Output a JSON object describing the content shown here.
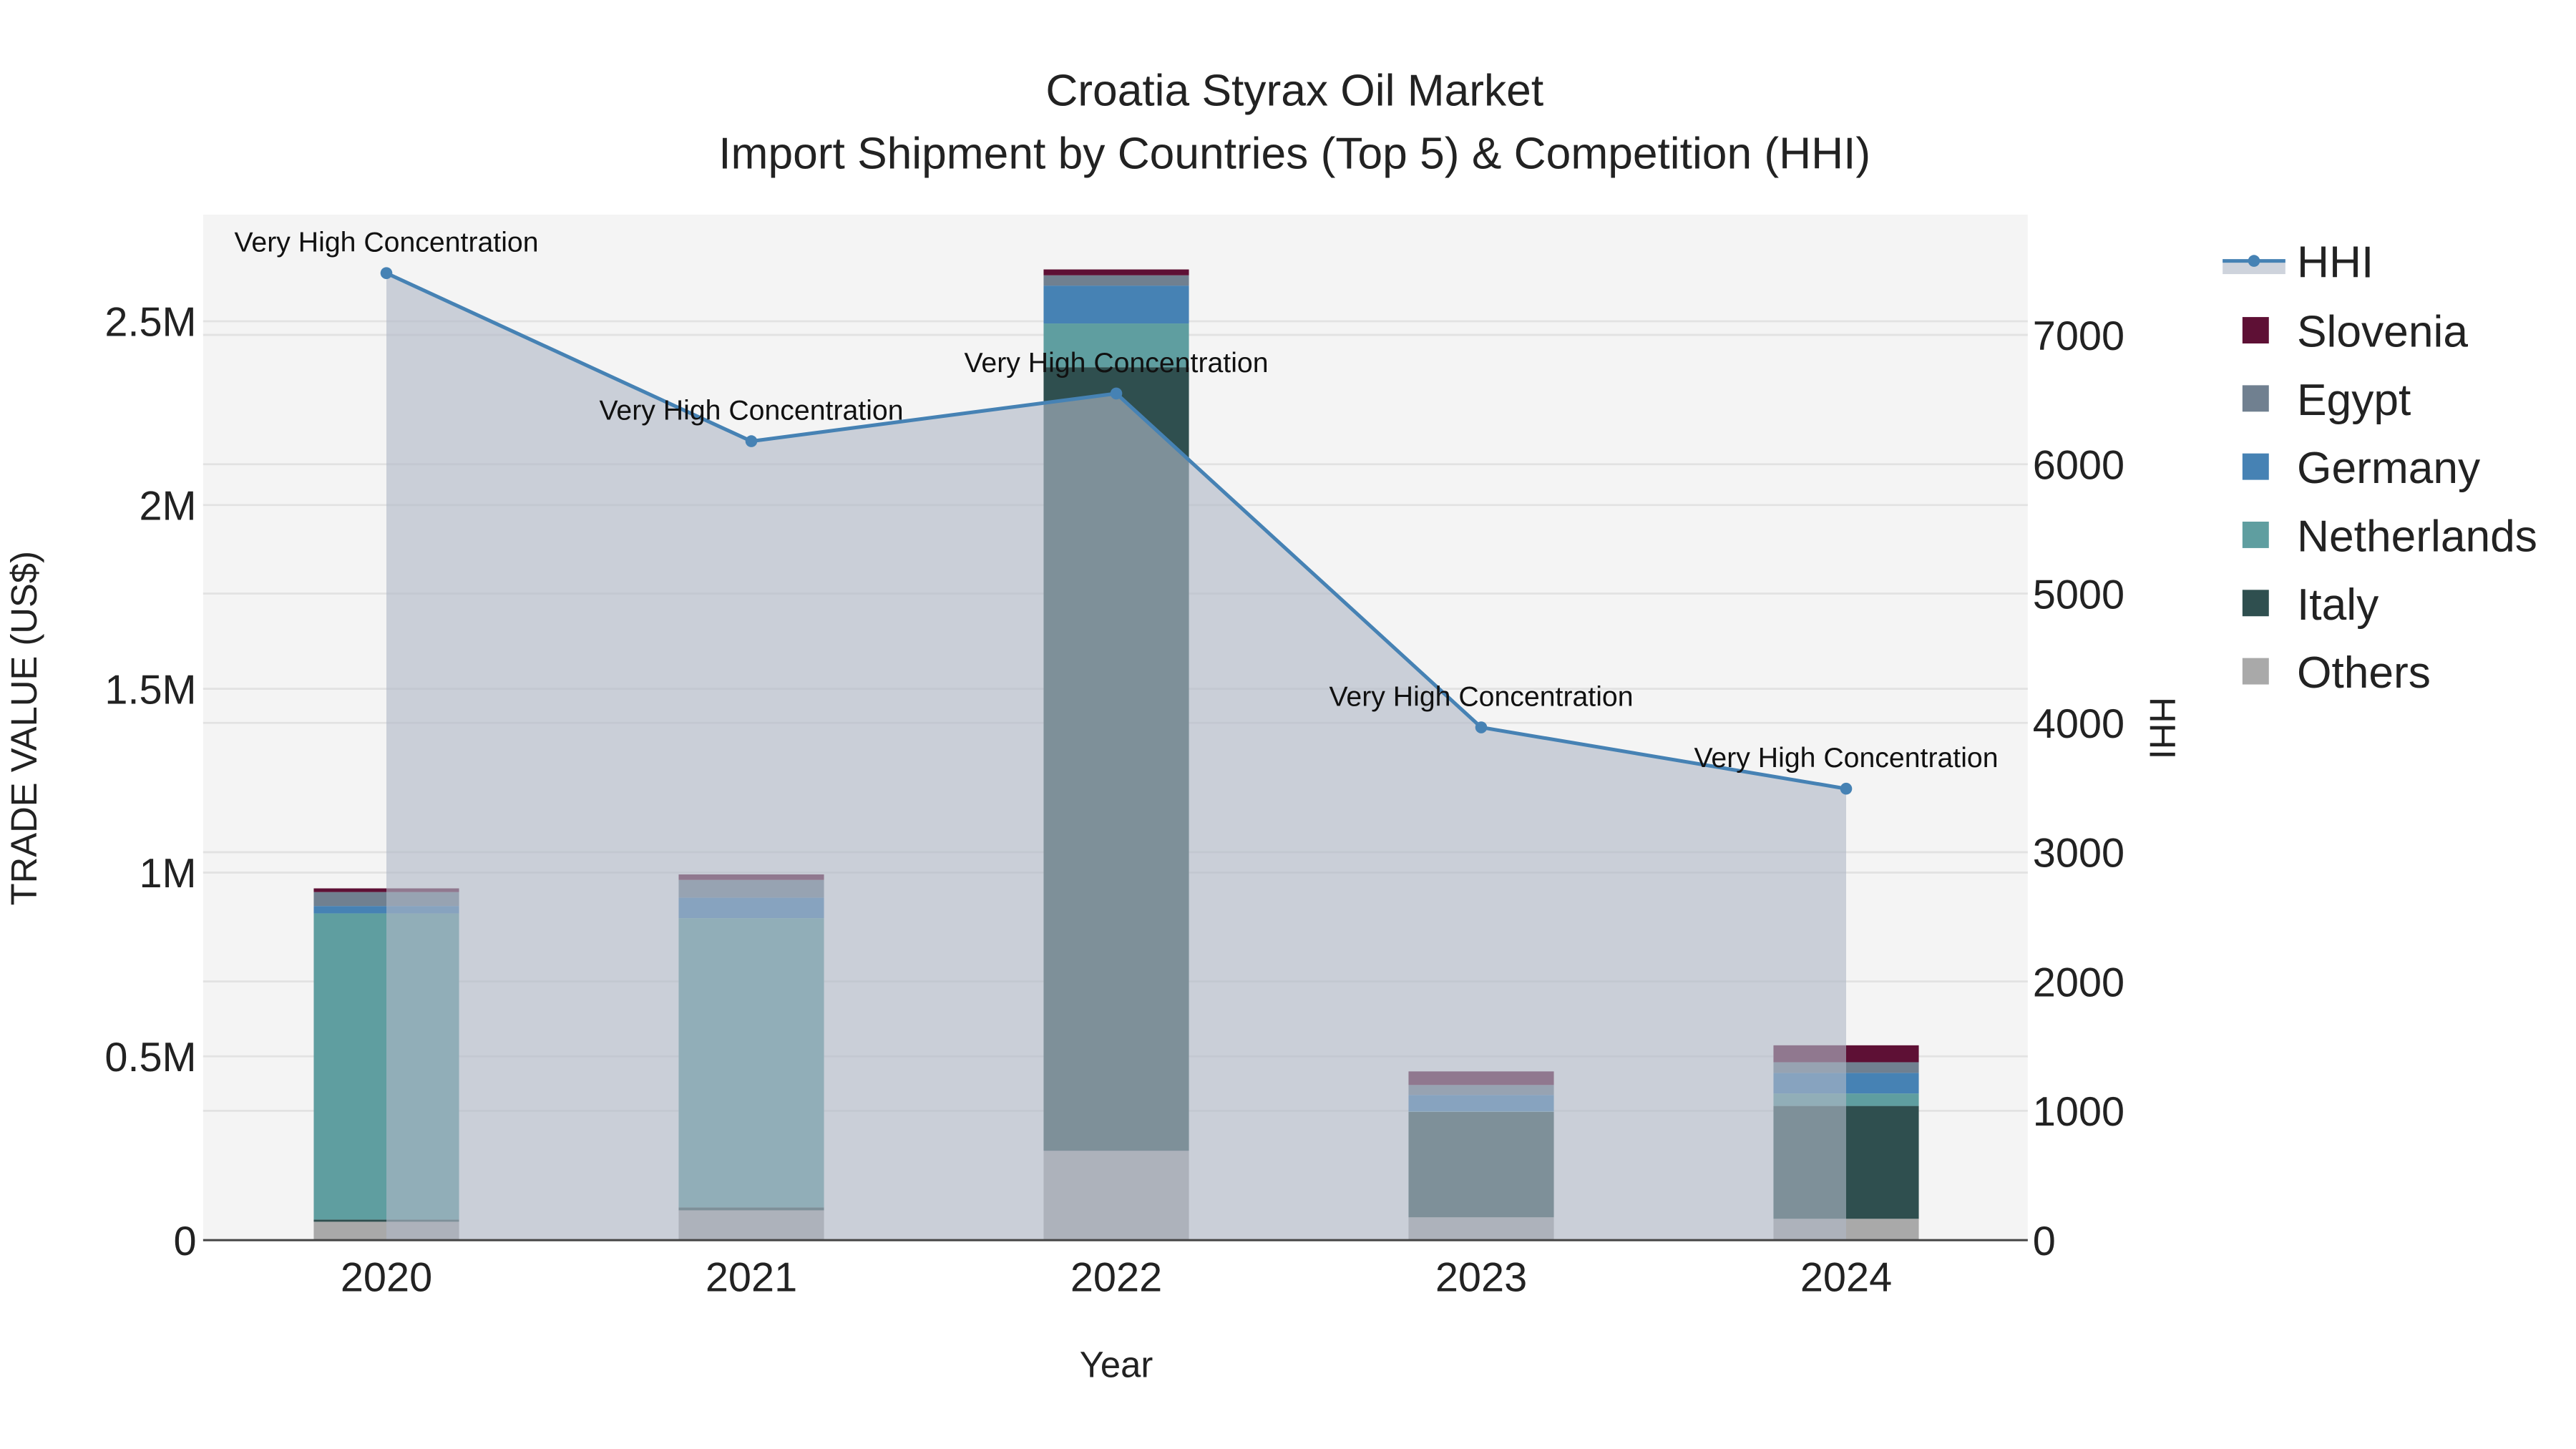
{
  "chart_data": {
    "type": "bar",
    "title": "Croatia Styrax Oil Market",
    "subtitle": "Import Shipment by Countries (Top 5) & Competition (HHI)",
    "xlabel": "Year",
    "ylabel": "TRADE VALUE (US$)",
    "y2label": "HHI",
    "categories": [
      "2020",
      "2021",
      "2022",
      "2023",
      "2024"
    ],
    "ylim": [
      0,
      2790000
    ],
    "y2lim": [
      0,
      7930
    ],
    "yticks": [
      {
        "v": 0,
        "label": "0"
      },
      {
        "v": 500000,
        "label": "0.5M"
      },
      {
        "v": 1000000,
        "label": "1M"
      },
      {
        "v": 1500000,
        "label": "1.5M"
      },
      {
        "v": 2000000,
        "label": "2M"
      },
      {
        "v": 2500000,
        "label": "2.5M"
      }
    ],
    "y2ticks": [
      {
        "v": 0,
        "label": "0"
      },
      {
        "v": 1000,
        "label": "1000"
      },
      {
        "v": 2000,
        "label": "2000"
      },
      {
        "v": 3000,
        "label": "3000"
      },
      {
        "v": 4000,
        "label": "4000"
      },
      {
        "v": 5000,
        "label": "5000"
      },
      {
        "v": 6000,
        "label": "6000"
      },
      {
        "v": 7000,
        "label": "7000"
      }
    ],
    "stacked": true,
    "series": [
      {
        "name": "Others",
        "color": "#a9a9a9",
        "values": [
          50000,
          81000,
          243000,
          62000,
          58000
        ]
      },
      {
        "name": "Italy",
        "color": "#2f4f4f",
        "values": [
          6000,
          8000,
          2132000,
          287000,
          307000
        ]
      },
      {
        "name": "Netherlands",
        "color": "#5f9ea0",
        "values": [
          833000,
          787000,
          119000,
          1000,
          34000
        ]
      },
      {
        "name": "Germany",
        "color": "#4682b4",
        "values": [
          20000,
          56000,
          103000,
          45000,
          56000
        ]
      },
      {
        "name": "Egypt",
        "color": "#708090",
        "values": [
          38000,
          48000,
          28000,
          27000,
          29000
        ]
      },
      {
        "name": "Slovenia",
        "color": "#5e1035",
        "values": [
          10000,
          15000,
          16000,
          37000,
          46000
        ]
      }
    ],
    "hhi": {
      "name": "HHI",
      "color": "#4682b4",
      "values": [
        7478,
        6178,
        6547,
        3965,
        3491
      ],
      "annotations": [
        "Very High Concentration",
        "Very High Concentration",
        "Very High Concentration",
        "Very High Concentration",
        "Very High Concentration"
      ]
    },
    "legend_order": [
      "HHI",
      "Slovenia",
      "Egypt",
      "Germany",
      "Netherlands",
      "Italy",
      "Others"
    ],
    "legend_placement": "top-right outside",
    "grid": true
  }
}
